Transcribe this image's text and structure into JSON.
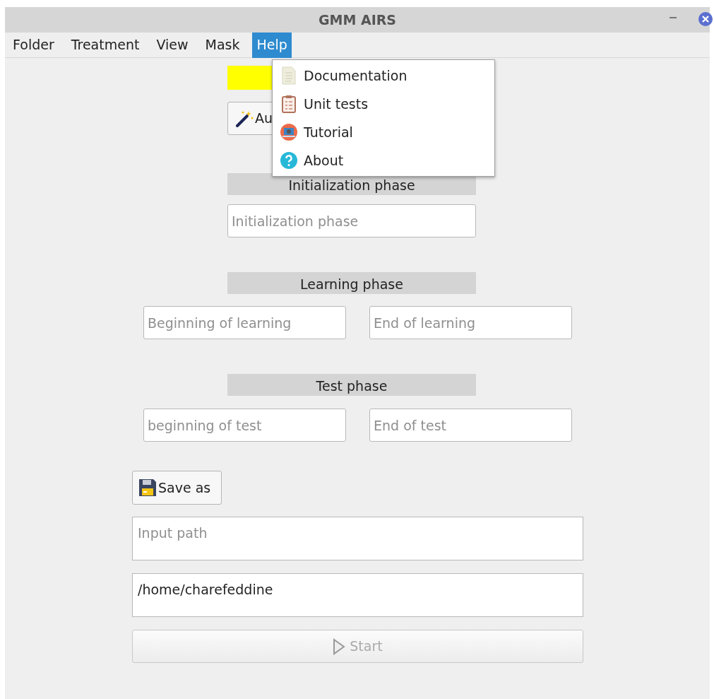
{
  "window": {
    "title": "GMM AIRS"
  },
  "menu_bar": [
    {
      "label": "Folder",
      "selected": false
    },
    {
      "label": "Treatment",
      "selected": false
    },
    {
      "label": "View",
      "selected": false
    },
    {
      "label": "Mask",
      "selected": false
    },
    {
      "label": "Help",
      "selected": true
    }
  ],
  "help_menu": [
    {
      "label": "Documentation",
      "kind": "document"
    },
    {
      "label": "Unit tests",
      "kind": "checklist"
    },
    {
      "label": "Tutorial",
      "kind": "tutorial"
    },
    {
      "label": "About",
      "kind": "about"
    }
  ],
  "auto_button": {
    "label": "Au"
  },
  "initialization": {
    "title": "Initialization phase",
    "field": {
      "placeholder": "Initialization phase"
    }
  },
  "learning": {
    "title": "Learning phase",
    "fields": [
      {
        "placeholder": "Beginning of learning"
      },
      {
        "placeholder": "End of learning"
      }
    ]
  },
  "test": {
    "title": "Test phase",
    "fields": [
      {
        "placeholder": "beginning of test"
      },
      {
        "placeholder": "End of test"
      }
    ]
  },
  "save_button": {
    "label": "Save as"
  },
  "input_path": {
    "placeholder": "Input path"
  },
  "output_path": {
    "value": "/home/charefeddine"
  },
  "start_button": {
    "label": "Start",
    "disabled": true
  }
}
